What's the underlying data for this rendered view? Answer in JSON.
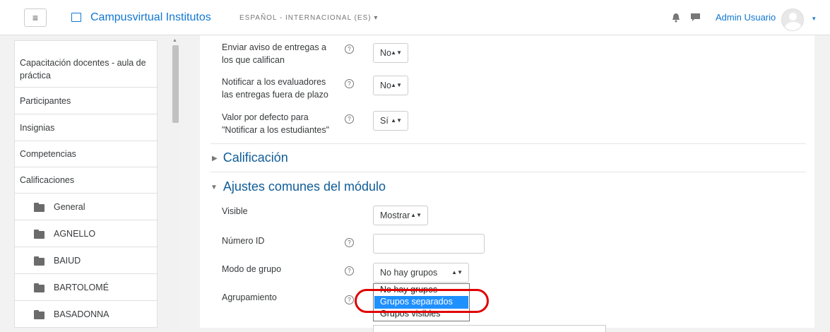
{
  "header": {
    "menu_icon": "hamburger-icon",
    "site_name": "Campusvirtual Institutos",
    "language": "ESPAÑOL - INTERNACIONAL (ES)",
    "language_caret": "▾",
    "user_name": "Admin Usuario",
    "user_caret": "▾"
  },
  "sidebar": {
    "items": [
      {
        "label": "Capacitación docentes - aula de práctica"
      },
      {
        "label": "Participantes"
      },
      {
        "label": "Insignias"
      },
      {
        "label": "Competencias"
      },
      {
        "label": "Calificaciones"
      },
      {
        "label": "General",
        "icon": "folder-icon"
      },
      {
        "label": "AGNELLO",
        "icon": "folder-icon"
      },
      {
        "label": "BAIUD",
        "icon": "folder-icon"
      },
      {
        "label": "BARTOLOMÉ",
        "icon": "folder-icon"
      },
      {
        "label": "BASADONNA",
        "icon": "folder-icon"
      }
    ]
  },
  "form": {
    "notify_graders": {
      "label": "Enviar aviso de entregas a los que califican",
      "value": "No"
    },
    "notify_late": {
      "label": "Notificar a los evaluadores las entregas fuera de plazo",
      "value": "No"
    },
    "notify_students": {
      "label": "Valor por defecto para \"Notificar a los estudiantes\"",
      "value": "Sí"
    },
    "section_grade": "Calificación",
    "section_common": "Ajustes comunes del módulo",
    "visible": {
      "label": "Visible",
      "value": "Mostrar"
    },
    "id_number": {
      "label": "Número ID",
      "value": ""
    },
    "group_mode": {
      "label": "Modo de grupo",
      "value": "No hay grupos",
      "options": [
        "No hay grupos",
        "Grupos separados",
        "Grupos visibles"
      ],
      "highlighted": "Grupos separados"
    },
    "grouping": {
      "label": "Agrupamiento"
    }
  },
  "colors": {
    "link": "#1177d1",
    "section": "#0f5c97",
    "highlight": "#1e90ff",
    "annotation": "#e00000"
  }
}
